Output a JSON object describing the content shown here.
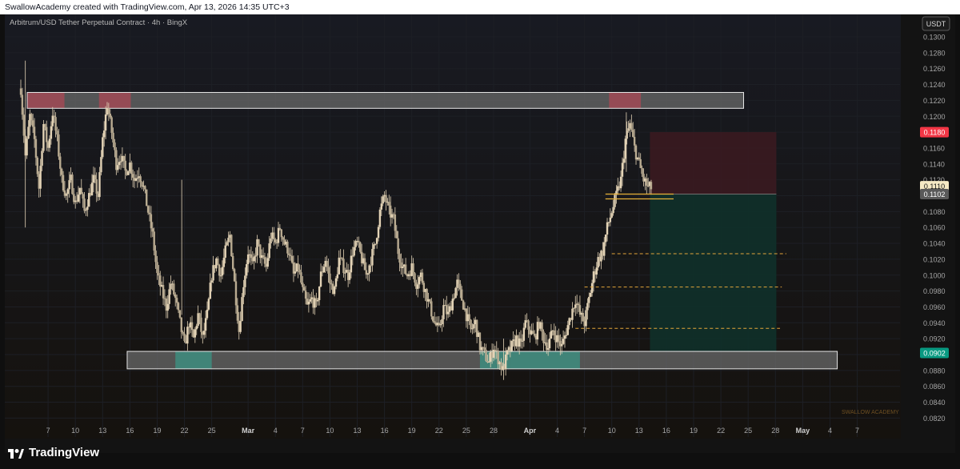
{
  "header": {
    "credit": "SwallowAcademy created with TradingView.com, Apr 13, 2026 14:35 UTC+3"
  },
  "footer": {
    "brand": "TradingView"
  },
  "colors": {
    "background": "#131313",
    "candle": "#e3d3b6",
    "zone_fill": "#6a6a6a",
    "zone_red": "#9c4a55",
    "zone_green": "#3f8a7c",
    "stop_fill": "#3a1a20",
    "target_fill": "#10302a",
    "dashed": "#e2a53a",
    "price_red": "#f23645",
    "price_green": "#089981",
    "entry_tag": "#f5e9c4"
  },
  "chart_data": {
    "type": "candlestick",
    "title": "Arbitrum/USD Tether Perpetual Contract · 4h · BingX",
    "currency": "USDT",
    "ylim": [
      0.081,
      0.131
    ],
    "yticks": [
      "0.1300",
      "0.1280",
      "0.1260",
      "0.1240",
      "0.1220",
      "0.1200",
      "0.1180",
      "0.1160",
      "0.1140",
      "0.1120",
      "0.1110",
      "0.1102",
      "0.1080",
      "0.1060",
      "0.1040",
      "0.1020",
      "0.1000",
      "0.0980",
      "0.0960",
      "0.0940",
      "0.0920",
      "0.0902",
      "0.0880",
      "0.0860",
      "0.0840",
      "0.0820"
    ],
    "xlim": [
      0,
      150
    ],
    "xticks": [
      {
        "d": 3,
        "label": "7"
      },
      {
        "d": 6,
        "label": "10"
      },
      {
        "d": 9,
        "label": "13"
      },
      {
        "d": 12,
        "label": "16"
      },
      {
        "d": 15,
        "label": "19"
      },
      {
        "d": 18,
        "label": "22"
      },
      {
        "d": 21,
        "label": "25"
      },
      {
        "d": 25,
        "label": "Mar",
        "bold": true
      },
      {
        "d": 28,
        "label": "4"
      },
      {
        "d": 31,
        "label": "7"
      },
      {
        "d": 34,
        "label": "10"
      },
      {
        "d": 37,
        "label": "13"
      },
      {
        "d": 40,
        "label": "16"
      },
      {
        "d": 43,
        "label": "19"
      },
      {
        "d": 46,
        "label": "22"
      },
      {
        "d": 49,
        "label": "25"
      },
      {
        "d": 52,
        "label": "28"
      },
      {
        "d": 56,
        "label": "Apr",
        "bold": true
      },
      {
        "d": 59,
        "label": "4"
      },
      {
        "d": 62,
        "label": "7"
      },
      {
        "d": 65,
        "label": "10"
      },
      {
        "d": 68,
        "label": "13"
      },
      {
        "d": 71,
        "label": "16"
      },
      {
        "d": 74,
        "label": "19"
      },
      {
        "d": 77,
        "label": "22"
      },
      {
        "d": 80,
        "label": "25"
      },
      {
        "d": 83,
        "label": "28"
      },
      {
        "d": 86,
        "label": "May",
        "bold": true
      },
      {
        "d": 89,
        "label": "4"
      },
      {
        "d": 92,
        "label": "7"
      }
    ],
    "close_path": [
      [
        0,
        0.1235
      ],
      [
        0.5,
        0.115
      ],
      [
        1,
        0.12
      ],
      [
        1.5,
        0.117
      ],
      [
        2,
        0.111
      ],
      [
        2.5,
        0.119
      ],
      [
        3,
        0.116
      ],
      [
        3.5,
        0.1205
      ],
      [
        4,
        0.117
      ],
      [
        4.5,
        0.112
      ],
      [
        5,
        0.11
      ],
      [
        5.5,
        0.112
      ],
      [
        6,
        0.109
      ],
      [
        6.5,
        0.111
      ],
      [
        7,
        0.108
      ],
      [
        7.5,
        0.11
      ],
      [
        8,
        0.112
      ],
      [
        8.5,
        0.11
      ],
      [
        9,
        0.117
      ],
      [
        9.5,
        0.1215
      ],
      [
        10,
        0.118
      ],
      [
        10.5,
        0.114
      ],
      [
        11,
        0.115
      ],
      [
        11.5,
        0.113
      ],
      [
        12,
        0.114
      ],
      [
        12.5,
        0.112
      ],
      [
        13,
        0.113
      ],
      [
        13.5,
        0.111
      ],
      [
        14,
        0.108
      ],
      [
        14.5,
        0.105
      ],
      [
        15,
        0.1
      ],
      [
        15.5,
        0.098
      ],
      [
        16,
        0.096
      ],
      [
        16.5,
        0.099
      ],
      [
        17,
        0.097
      ],
      [
        17.5,
        0.094
      ],
      [
        18,
        0.091
      ],
      [
        18.5,
        0.094
      ],
      [
        19,
        0.092
      ],
      [
        19.5,
        0.095
      ],
      [
        20,
        0.092
      ],
      [
        20.5,
        0.095
      ],
      [
        21,
        0.1
      ],
      [
        21.5,
        0.102
      ],
      [
        22,
        0.1
      ],
      [
        22.5,
        0.103
      ],
      [
        23,
        0.105
      ],
      [
        23.5,
        0.099
      ],
      [
        24,
        0.093
      ],
      [
        24.5,
        0.099
      ],
      [
        25,
        0.103
      ],
      [
        25.5,
        0.101
      ],
      [
        26,
        0.104
      ],
      [
        26.5,
        0.102
      ],
      [
        27,
        0.101
      ],
      [
        27.5,
        0.105
      ],
      [
        28,
        0.104
      ],
      [
        28.5,
        0.106
      ],
      [
        29,
        0.104
      ],
      [
        29.5,
        0.103
      ],
      [
        30,
        0.1
      ],
      [
        30.5,
        0.101
      ],
      [
        31,
        0.098
      ],
      [
        31.5,
        0.096
      ],
      [
        32,
        0.097
      ],
      [
        32.5,
        0.096
      ],
      [
        33,
        0.1
      ],
      [
        33.5,
        0.102
      ],
      [
        34,
        0.099
      ],
      [
        34.5,
        0.098
      ],
      [
        35,
        0.102
      ],
      [
        35.5,
        0.101
      ],
      [
        36,
        0.1
      ],
      [
        36.5,
        0.103
      ],
      [
        37,
        0.104
      ],
      [
        37.5,
        0.102
      ],
      [
        38,
        0.1
      ],
      [
        38.5,
        0.102
      ],
      [
        39,
        0.104
      ],
      [
        39.5,
        0.108
      ],
      [
        40,
        0.11
      ],
      [
        40.5,
        0.108
      ],
      [
        41,
        0.107
      ],
      [
        41.5,
        0.103
      ],
      [
        42,
        0.101
      ],
      [
        42.5,
        0.1
      ],
      [
        43,
        0.101
      ],
      [
        43.5,
        0.099
      ],
      [
        44,
        0.1
      ],
      [
        44.5,
        0.098
      ],
      [
        45,
        0.096
      ],
      [
        45.5,
        0.094
      ],
      [
        46,
        0.093
      ],
      [
        46.5,
        0.096
      ],
      [
        47,
        0.095
      ],
      [
        47.5,
        0.097
      ],
      [
        48,
        0.099
      ],
      [
        48.5,
        0.097
      ],
      [
        49,
        0.095
      ],
      [
        49.5,
        0.093
      ],
      [
        50,
        0.094
      ],
      [
        50.5,
        0.091
      ],
      [
        51,
        0.09
      ],
      [
        51.5,
        0.089
      ],
      [
        52,
        0.091
      ],
      [
        52.5,
        0.0895
      ],
      [
        53,
        0.088
      ],
      [
        53.5,
        0.09
      ],
      [
        54,
        0.091
      ],
      [
        54.5,
        0.092
      ],
      [
        55,
        0.091
      ],
      [
        55.5,
        0.094
      ],
      [
        56,
        0.093
      ],
      [
        56.5,
        0.092
      ],
      [
        57,
        0.094
      ],
      [
        57.5,
        0.092
      ],
      [
        58,
        0.091
      ],
      [
        58.5,
        0.093
      ],
      [
        59,
        0.092
      ],
      [
        59.5,
        0.091
      ],
      [
        60,
        0.093
      ],
      [
        60.5,
        0.095
      ],
      [
        61,
        0.097
      ],
      [
        61.5,
        0.095
      ],
      [
        62,
        0.094
      ],
      [
        62.5,
        0.097
      ],
      [
        63,
        0.1
      ],
      [
        63.5,
        0.102
      ],
      [
        64,
        0.103
      ],
      [
        64.5,
        0.106
      ],
      [
        65,
        0.108
      ],
      [
        65.5,
        0.11
      ],
      [
        66,
        0.112
      ],
      [
        66.5,
        0.117
      ],
      [
        67,
        0.119
      ],
      [
        67.5,
        0.116
      ],
      [
        68,
        0.114
      ],
      [
        68.5,
        0.112
      ],
      [
        69,
        0.111
      ],
      [
        69.5,
        0.111
      ]
    ],
    "zones": [
      {
        "x0": 0.7,
        "x1": 79.5,
        "y0": 0.121,
        "y1": 0.123,
        "highlights": [
          [
            0.7,
            4.8
          ],
          [
            8.6,
            12.1
          ],
          [
            64.7,
            68.2
          ]
        ],
        "tone": "red"
      },
      {
        "x0": 11.7,
        "x1": 89.8,
        "y0": 0.0882,
        "y1": 0.0904,
        "highlights": [
          [
            17,
            21
          ],
          [
            50.5,
            53.8
          ],
          [
            53.8,
            61.5
          ]
        ],
        "tone": "green"
      }
    ],
    "position": {
      "x0": 69.2,
      "x1": 83.1,
      "stop": 0.118,
      "entry": 0.1102,
      "target": 0.0904
    },
    "entry_lines": [
      0.1102,
      0.1096
    ],
    "targets": [
      {
        "x0": 65,
        "x1": 84.2,
        "y": 0.1027
      },
      {
        "x0": 62,
        "x1": 83.7,
        "y": 0.0985
      },
      {
        "x0": 61,
        "x1": 83.5,
        "y": 0.0933
      }
    ],
    "price_tags": [
      {
        "value": 0.118,
        "label": "0.1180",
        "kind": "red"
      },
      {
        "value": 0.1112,
        "label": "0.1110",
        "kind": "entry"
      },
      {
        "value": 0.1102,
        "label": "0.1102",
        "kind": "neutral"
      },
      {
        "value": 0.0902,
        "label": "0.0902",
        "kind": "green"
      }
    ],
    "watermark": "SWALLOW ACADEMY"
  }
}
